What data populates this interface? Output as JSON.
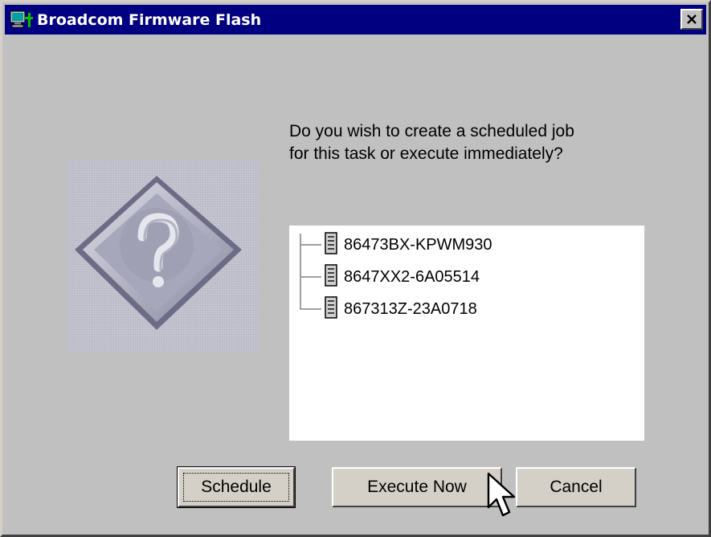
{
  "window": {
    "title": "Broadcom Firmware Flash"
  },
  "dialog": {
    "message_line1": "Do you wish to create a scheduled job",
    "message_line2": "for this task or execute immediately?",
    "icon": "question-diamond-icon"
  },
  "tree": {
    "items": [
      {
        "label": "86473BX-KPWM930",
        "icon": "server-icon"
      },
      {
        "label": "8647XX2-6A05514",
        "icon": "server-icon"
      },
      {
        "label": "867313Z-23A0718",
        "icon": "server-icon"
      }
    ]
  },
  "buttons": {
    "schedule": "Schedule",
    "execute_now": "Execute Now",
    "cancel": "Cancel"
  },
  "colors": {
    "titlebar": "#000080",
    "window_bg": "#c0c0c0",
    "panel_bg": "#ffffff"
  }
}
